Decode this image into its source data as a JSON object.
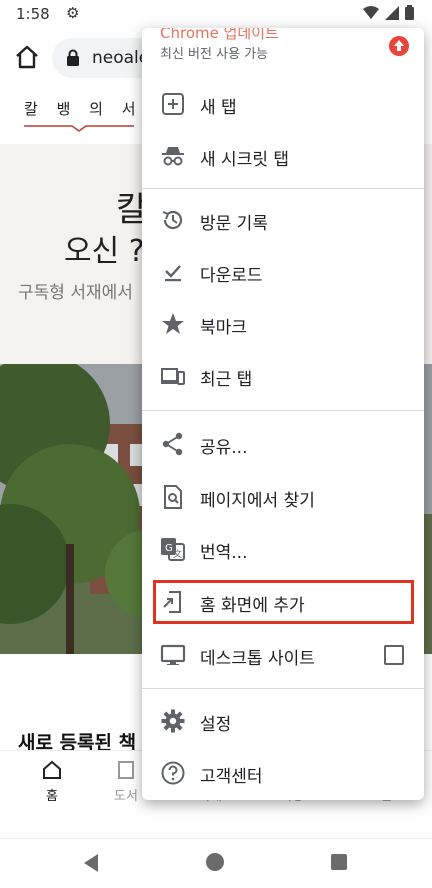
{
  "status_bar": {
    "time": "1:58"
  },
  "toolbar": {
    "url": "neoale"
  },
  "page": {
    "logo_text": "칼 뱅 의 서 재",
    "hero_line1": "칼",
    "hero_line2": "오신 ?",
    "hero_sub": "구독형 서재에서",
    "section_title": "새로 등록된 책",
    "bottom_tabs": [
      {
        "label": "홈"
      },
      {
        "label": "도서"
      },
      {
        "label": "서재"
      },
      {
        "label": "저장"
      },
      {
        "label": "로그인"
      }
    ]
  },
  "menu": {
    "update_title": "Chrome 업데이트",
    "update_subtitle": "최신 버전 사용 가능",
    "items": [
      {
        "label": "새 탭",
        "icon": "new-tab-icon"
      },
      {
        "label": "새 시크릿 탭",
        "icon": "incognito-icon"
      },
      {
        "label": "방문 기록",
        "icon": "history-icon"
      },
      {
        "label": "다운로드",
        "icon": "download-icon"
      },
      {
        "label": "북마크",
        "icon": "star-icon"
      },
      {
        "label": "최근 탭",
        "icon": "devices-icon"
      },
      {
        "label": "공유...",
        "icon": "share-icon"
      },
      {
        "label": "페이지에서 찾기",
        "icon": "find-in-page-icon"
      },
      {
        "label": "번역...",
        "icon": "translate-icon"
      },
      {
        "label": "홈 화면에 추가",
        "icon": "add-to-home-icon"
      },
      {
        "label": "데스크톱 사이트",
        "icon": "desktop-icon",
        "checked": false
      },
      {
        "label": "설정",
        "icon": "settings-icon"
      },
      {
        "label": "고객센터",
        "icon": "help-icon"
      }
    ],
    "highlight_color": "#e0321e"
  }
}
